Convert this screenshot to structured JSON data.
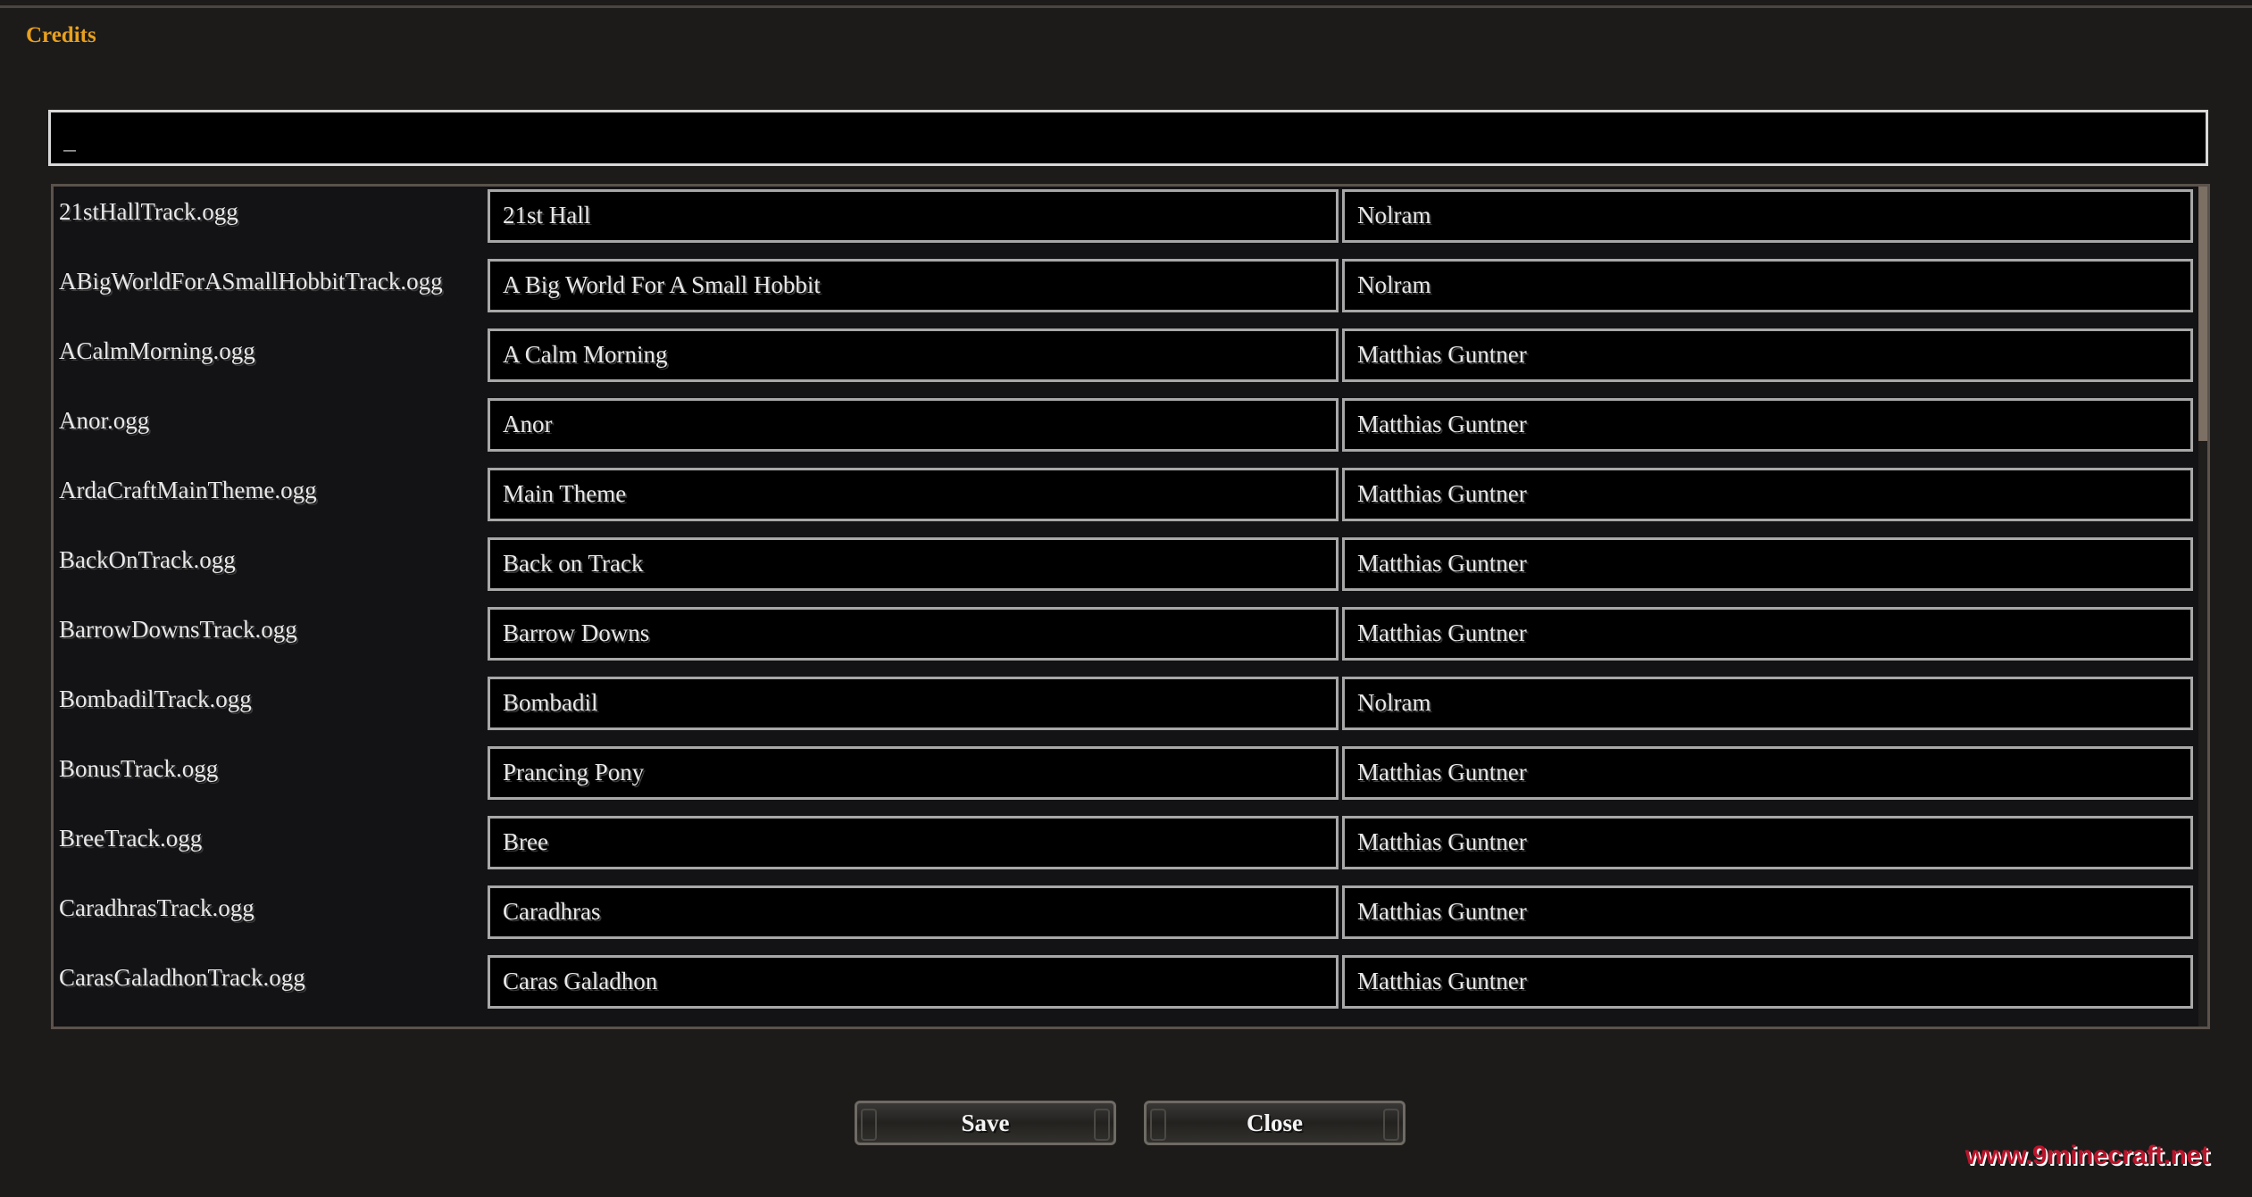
{
  "window": {
    "title": "Credits"
  },
  "search": {
    "value": "_"
  },
  "tracks": [
    {
      "file": "21stHallTrack.ogg",
      "title": "21st Hall",
      "author": "Nolram"
    },
    {
      "file": "ABigWorldForASmallHobbitTrack.ogg",
      "title": "A Big World For A Small Hobbit",
      "author": "Nolram"
    },
    {
      "file": "ACalmMorning.ogg",
      "title": "A Calm Morning",
      "author": "Matthias Guntner"
    },
    {
      "file": "Anor.ogg",
      "title": "Anor",
      "author": "Matthias Guntner"
    },
    {
      "file": "ArdaCraftMainTheme.ogg",
      "title": "Main Theme",
      "author": "Matthias Guntner"
    },
    {
      "file": "BackOnTrack.ogg",
      "title": "Back on Track",
      "author": "Matthias Guntner"
    },
    {
      "file": "BarrowDownsTrack.ogg",
      "title": "Barrow Downs",
      "author": "Matthias Guntner"
    },
    {
      "file": "BombadilTrack.ogg",
      "title": "Bombadil",
      "author": "Nolram"
    },
    {
      "file": "BonusTrack.ogg",
      "title": "Prancing Pony",
      "author": "Matthias Guntner"
    },
    {
      "file": "BreeTrack.ogg",
      "title": "Bree",
      "author": "Matthias Guntner"
    },
    {
      "file": "CaradhrasTrack.ogg",
      "title": "Caradhras",
      "author": "Matthias Guntner"
    },
    {
      "file": "CarasGaladhonTrack.ogg",
      "title": "Caras Galadhon",
      "author": "Matthias Guntner"
    }
  ],
  "buttons": {
    "save": "Save",
    "close": "Close"
  },
  "watermark": "www.9minecraft.net",
  "colors": {
    "accent": "#e8a020",
    "background": "#1c1b1a",
    "panel": "#131215",
    "watermark": "#b8142a"
  }
}
